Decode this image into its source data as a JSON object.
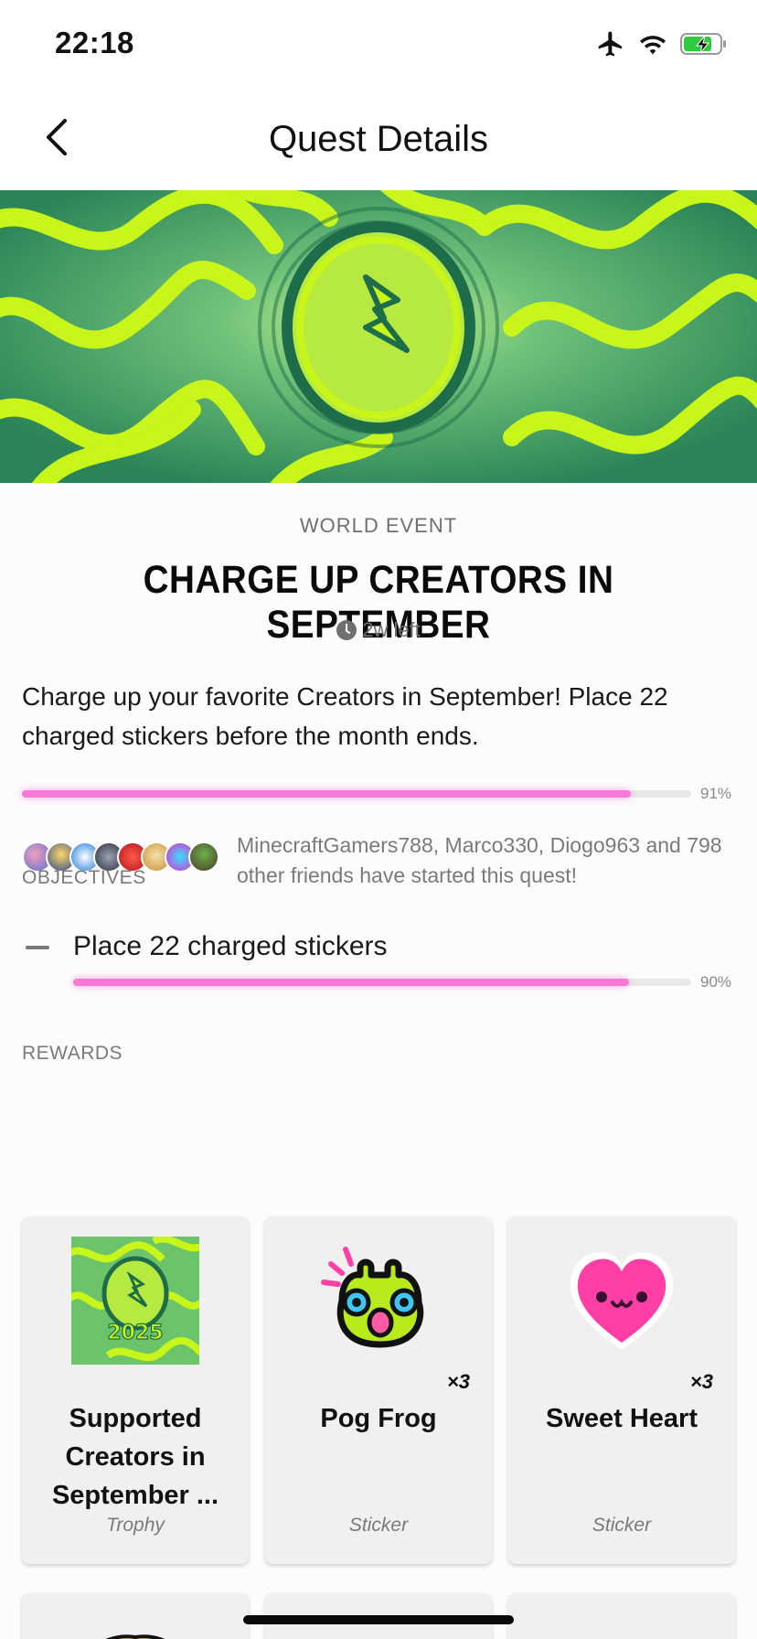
{
  "status_bar": {
    "time": "22:18",
    "icons": [
      "airplane-icon",
      "wifi-icon",
      "battery-charging-icon"
    ]
  },
  "nav": {
    "title": "Quest Details",
    "back_icon": "chevron-left-icon"
  },
  "quest": {
    "category": "WORLD EVENT",
    "title": "CHARGE UP CREATORS IN SEPTEMBER",
    "time_left": "2w left",
    "description": "Charge up your favorite Creators in September! Place 22 charged stickers before the month ends.",
    "progress": 0.91,
    "progress_label": "91%"
  },
  "friends": {
    "text": "MinecraftGamers788, Marco330, Diogo963 and 798 other friends have started this quest!"
  },
  "objectives": {
    "label": "OBJECTIVES",
    "items": [
      {
        "text": "Place 22 charged stickers",
        "progress": 0.9,
        "progress_label": "90%"
      }
    ]
  },
  "rewards": {
    "label": "REWARDS",
    "items": [
      {
        "name": "Supported Creators in September ...",
        "type": "Trophy",
        "quantity": "",
        "badge_text": "2025"
      },
      {
        "name": "Pog Frog",
        "type": "Sticker",
        "quantity": "×3"
      },
      {
        "name": "Sweet Heart",
        "type": "Sticker",
        "quantity": "×3"
      }
    ]
  },
  "colors": {
    "accent_progress": "#f47ad6",
    "hero_lime": "#c8f51a",
    "hero_green": "#2e8a5c",
    "heart_pink": "#ff3fa6",
    "frog_green": "#b8ea1c"
  }
}
